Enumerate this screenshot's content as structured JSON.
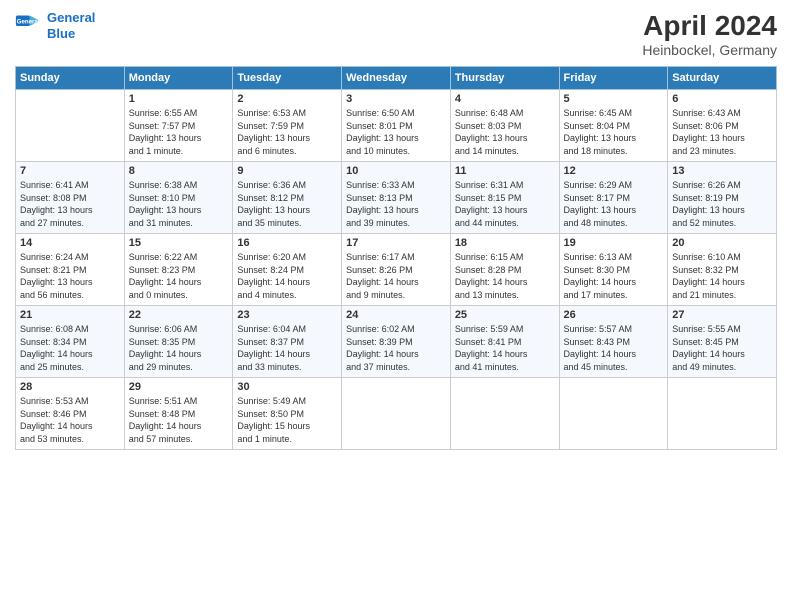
{
  "logo": {
    "line1": "General",
    "line2": "Blue"
  },
  "title": "April 2024",
  "subtitle": "Heinbockel, Germany",
  "headers": [
    "Sunday",
    "Monday",
    "Tuesday",
    "Wednesday",
    "Thursday",
    "Friday",
    "Saturday"
  ],
  "weeks": [
    [
      {
        "day": "",
        "info": ""
      },
      {
        "day": "1",
        "info": "Sunrise: 6:55 AM\nSunset: 7:57 PM\nDaylight: 13 hours\nand 1 minute."
      },
      {
        "day": "2",
        "info": "Sunrise: 6:53 AM\nSunset: 7:59 PM\nDaylight: 13 hours\nand 6 minutes."
      },
      {
        "day": "3",
        "info": "Sunrise: 6:50 AM\nSunset: 8:01 PM\nDaylight: 13 hours\nand 10 minutes."
      },
      {
        "day": "4",
        "info": "Sunrise: 6:48 AM\nSunset: 8:03 PM\nDaylight: 13 hours\nand 14 minutes."
      },
      {
        "day": "5",
        "info": "Sunrise: 6:45 AM\nSunset: 8:04 PM\nDaylight: 13 hours\nand 18 minutes."
      },
      {
        "day": "6",
        "info": "Sunrise: 6:43 AM\nSunset: 8:06 PM\nDaylight: 13 hours\nand 23 minutes."
      }
    ],
    [
      {
        "day": "7",
        "info": "Sunrise: 6:41 AM\nSunset: 8:08 PM\nDaylight: 13 hours\nand 27 minutes."
      },
      {
        "day": "8",
        "info": "Sunrise: 6:38 AM\nSunset: 8:10 PM\nDaylight: 13 hours\nand 31 minutes."
      },
      {
        "day": "9",
        "info": "Sunrise: 6:36 AM\nSunset: 8:12 PM\nDaylight: 13 hours\nand 35 minutes."
      },
      {
        "day": "10",
        "info": "Sunrise: 6:33 AM\nSunset: 8:13 PM\nDaylight: 13 hours\nand 39 minutes."
      },
      {
        "day": "11",
        "info": "Sunrise: 6:31 AM\nSunset: 8:15 PM\nDaylight: 13 hours\nand 44 minutes."
      },
      {
        "day": "12",
        "info": "Sunrise: 6:29 AM\nSunset: 8:17 PM\nDaylight: 13 hours\nand 48 minutes."
      },
      {
        "day": "13",
        "info": "Sunrise: 6:26 AM\nSunset: 8:19 PM\nDaylight: 13 hours\nand 52 minutes."
      }
    ],
    [
      {
        "day": "14",
        "info": "Sunrise: 6:24 AM\nSunset: 8:21 PM\nDaylight: 13 hours\nand 56 minutes."
      },
      {
        "day": "15",
        "info": "Sunrise: 6:22 AM\nSunset: 8:23 PM\nDaylight: 14 hours\nand 0 minutes."
      },
      {
        "day": "16",
        "info": "Sunrise: 6:20 AM\nSunset: 8:24 PM\nDaylight: 14 hours\nand 4 minutes."
      },
      {
        "day": "17",
        "info": "Sunrise: 6:17 AM\nSunset: 8:26 PM\nDaylight: 14 hours\nand 9 minutes."
      },
      {
        "day": "18",
        "info": "Sunrise: 6:15 AM\nSunset: 8:28 PM\nDaylight: 14 hours\nand 13 minutes."
      },
      {
        "day": "19",
        "info": "Sunrise: 6:13 AM\nSunset: 8:30 PM\nDaylight: 14 hours\nand 17 minutes."
      },
      {
        "day": "20",
        "info": "Sunrise: 6:10 AM\nSunset: 8:32 PM\nDaylight: 14 hours\nand 21 minutes."
      }
    ],
    [
      {
        "day": "21",
        "info": "Sunrise: 6:08 AM\nSunset: 8:34 PM\nDaylight: 14 hours\nand 25 minutes."
      },
      {
        "day": "22",
        "info": "Sunrise: 6:06 AM\nSunset: 8:35 PM\nDaylight: 14 hours\nand 29 minutes."
      },
      {
        "day": "23",
        "info": "Sunrise: 6:04 AM\nSunset: 8:37 PM\nDaylight: 14 hours\nand 33 minutes."
      },
      {
        "day": "24",
        "info": "Sunrise: 6:02 AM\nSunset: 8:39 PM\nDaylight: 14 hours\nand 37 minutes."
      },
      {
        "day": "25",
        "info": "Sunrise: 5:59 AM\nSunset: 8:41 PM\nDaylight: 14 hours\nand 41 minutes."
      },
      {
        "day": "26",
        "info": "Sunrise: 5:57 AM\nSunset: 8:43 PM\nDaylight: 14 hours\nand 45 minutes."
      },
      {
        "day": "27",
        "info": "Sunrise: 5:55 AM\nSunset: 8:45 PM\nDaylight: 14 hours\nand 49 minutes."
      }
    ],
    [
      {
        "day": "28",
        "info": "Sunrise: 5:53 AM\nSunset: 8:46 PM\nDaylight: 14 hours\nand 53 minutes."
      },
      {
        "day": "29",
        "info": "Sunrise: 5:51 AM\nSunset: 8:48 PM\nDaylight: 14 hours\nand 57 minutes."
      },
      {
        "day": "30",
        "info": "Sunrise: 5:49 AM\nSunset: 8:50 PM\nDaylight: 15 hours\nand 1 minute."
      },
      {
        "day": "",
        "info": ""
      },
      {
        "day": "",
        "info": ""
      },
      {
        "day": "",
        "info": ""
      },
      {
        "day": "",
        "info": ""
      }
    ]
  ]
}
